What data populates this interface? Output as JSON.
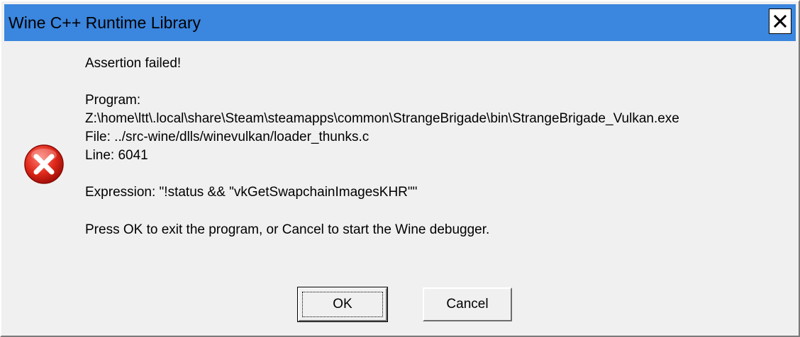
{
  "window": {
    "title": "Wine C++ Runtime Library",
    "titlebar_color": "#3b86de"
  },
  "icons": {
    "close": "close-icon",
    "error": "error-icon"
  },
  "message": {
    "line1": "Assertion failed!",
    "line2": "Program:",
    "line3": "Z:\\home\\ltt\\.local\\share\\Steam\\steamapps\\common\\StrangeBrigade\\bin\\StrangeBrigade_Vulkan.exe",
    "line4": "File: ../src-wine/dlls/winevulkan/loader_thunks.c",
    "line5": "Line: 6041",
    "line6": "Expression: \"!status && \"vkGetSwapchainImagesKHR\"\"",
    "line7": "Press OK to exit the program, or Cancel to start the Wine debugger."
  },
  "buttons": {
    "ok": "OK",
    "cancel": "Cancel"
  }
}
